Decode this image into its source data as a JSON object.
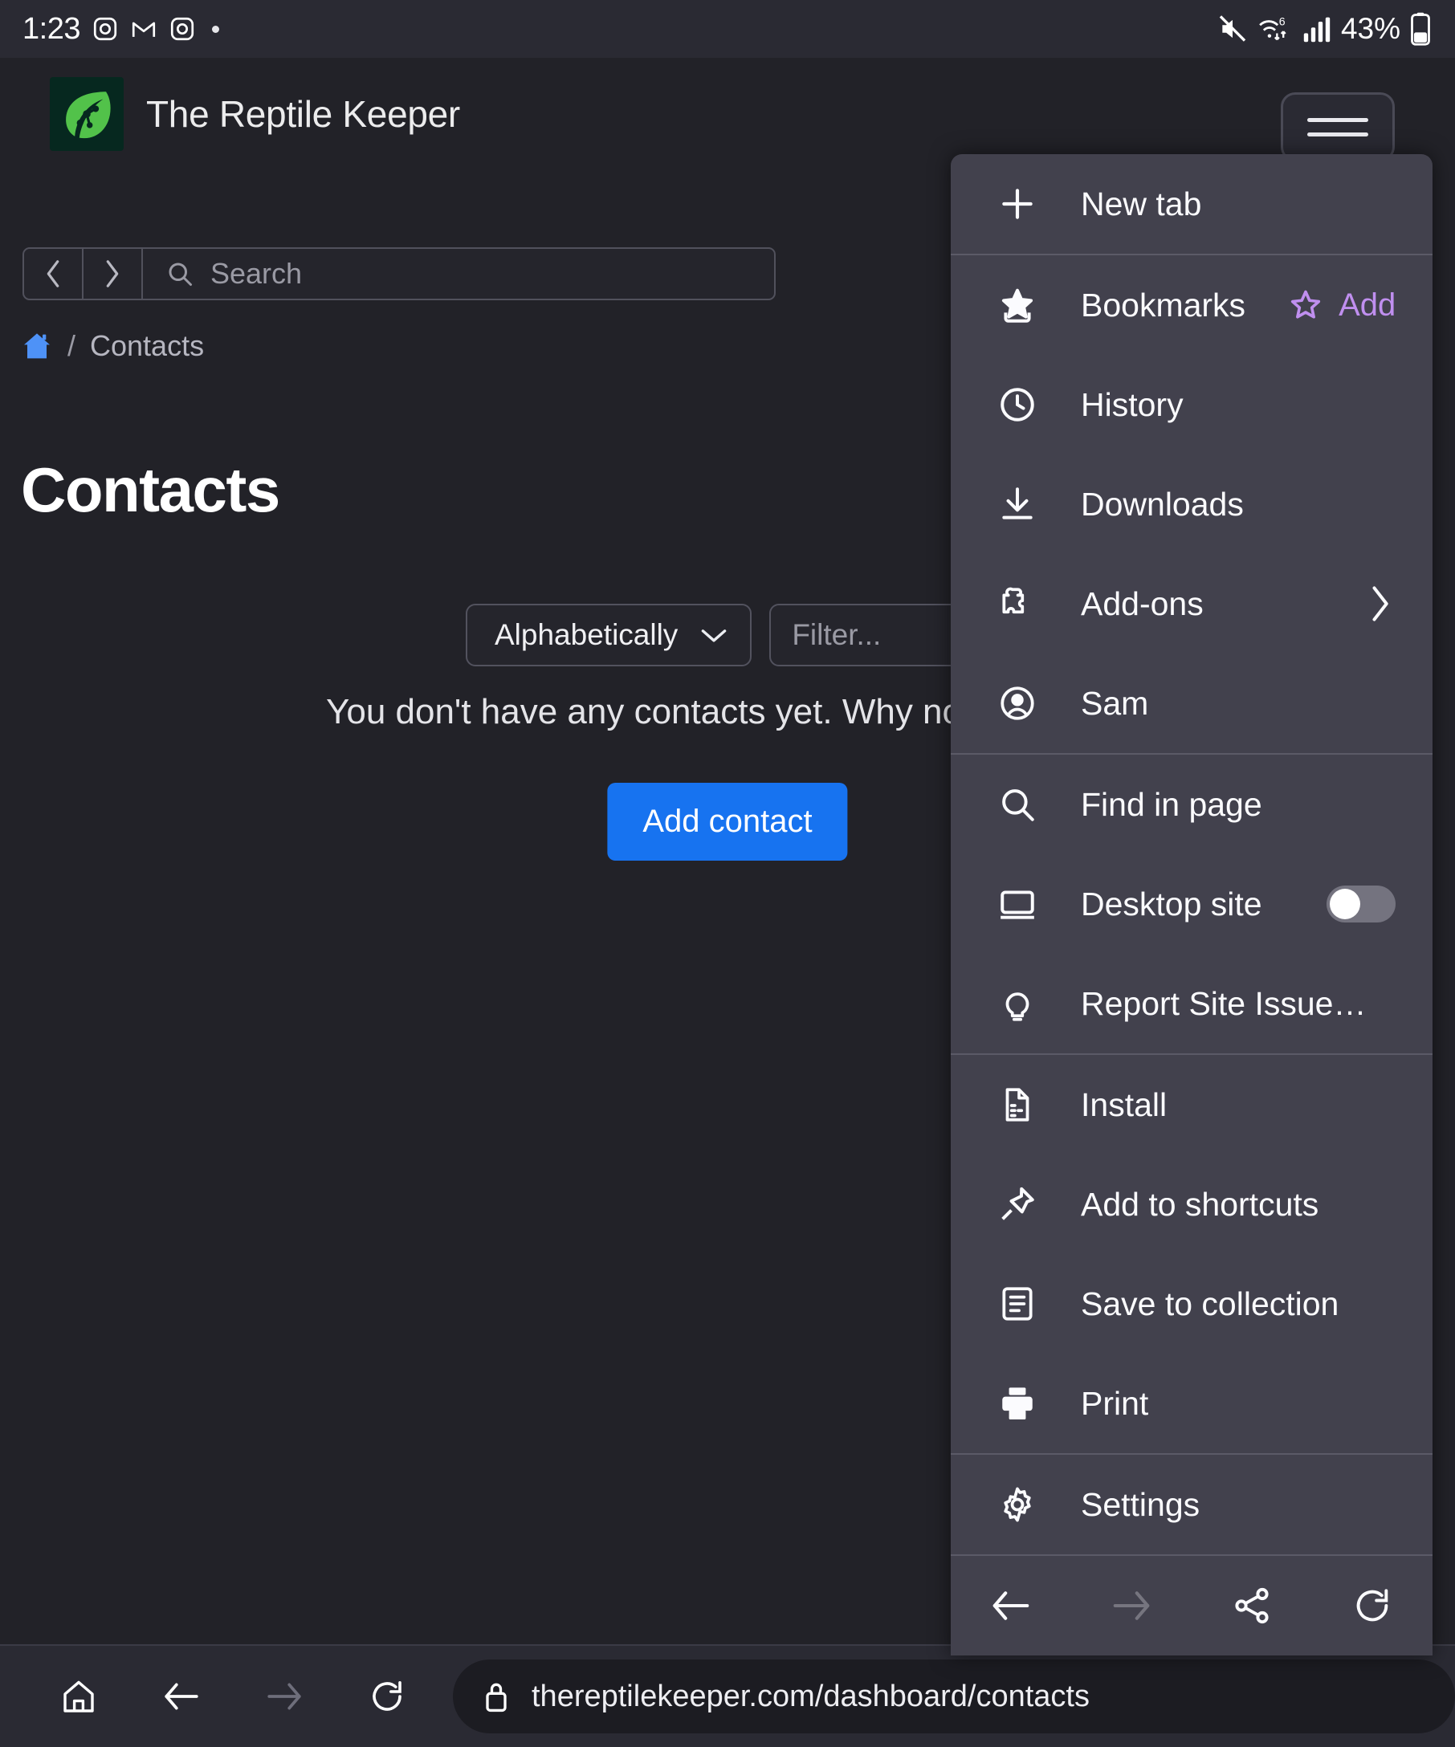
{
  "status_bar": {
    "time": "1:23",
    "left_icons": [
      "instagram-icon",
      "gmail-icon",
      "instagram-icon",
      "dot-indicator"
    ],
    "right_icons": [
      "mute-icon",
      "wifi6-icon",
      "signal-bars-icon",
      "battery-icon"
    ],
    "battery_percent": "43%"
  },
  "site_header": {
    "title": "The Reptile Keeper",
    "logo": "leaf-logo",
    "menu_button": "hamburger-menu"
  },
  "search": {
    "placeholder": "Search",
    "back_icon": "chevron-left-icon",
    "forward_icon": "chevron-right-icon",
    "search_icon": "search-icon"
  },
  "breadcrumb": {
    "home_icon": "home-icon",
    "separator": "/",
    "current": "Contacts"
  },
  "page": {
    "title": "Contacts",
    "sort_value": "Alphabetically",
    "sort_caret": "chevron-down-icon",
    "filter_placeholder": "Filter...",
    "empty_message": "You don't have any contacts yet. Why not add one?",
    "add_contact_label": "Add contact",
    "accent_color": "#1773f0"
  },
  "browser_toolbar": {
    "home_icon": "home-icon",
    "back_icon": "arrow-left-icon",
    "forward_icon": "arrow-right-icon",
    "reload_icon": "reload-icon",
    "lock_icon": "lock-icon",
    "url": "thereptilekeeper.com/dashboard/contacts"
  },
  "menu": {
    "accent_purple": "#c08fef",
    "panel_bg": "#42414d",
    "items": [
      {
        "label": "New tab",
        "icon": "plus-icon"
      },
      {
        "label": "Bookmarks",
        "icon": "bookmark-star-icon",
        "action_label": "Add",
        "action_icon": "star-outline-icon"
      },
      {
        "label": "History",
        "icon": "clock-icon"
      },
      {
        "label": "Downloads",
        "icon": "download-icon"
      },
      {
        "label": "Add-ons",
        "icon": "extension-icon",
        "chevron": "chevron-right-icon"
      },
      {
        "label": "Sam",
        "icon": "account-icon"
      },
      {
        "label": "Find in page",
        "icon": "search-icon"
      },
      {
        "label": "Desktop site",
        "icon": "desktop-icon",
        "toggle": "off"
      },
      {
        "label": "Report Site Issue…",
        "icon": "lightbulb-icon"
      },
      {
        "label": "Install",
        "icon": "install-icon"
      },
      {
        "label": "Add to shortcuts",
        "icon": "pin-icon"
      },
      {
        "label": "Save to collection",
        "icon": "collection-icon"
      },
      {
        "label": "Print",
        "icon": "print-icon"
      },
      {
        "label": "Settings",
        "icon": "gear-icon"
      }
    ],
    "nav": [
      {
        "icon": "arrow-left-icon",
        "state": "enabled"
      },
      {
        "icon": "arrow-right-icon",
        "state": "disabled"
      },
      {
        "icon": "share-icon",
        "state": "enabled"
      },
      {
        "icon": "reload-icon",
        "state": "enabled"
      }
    ]
  }
}
